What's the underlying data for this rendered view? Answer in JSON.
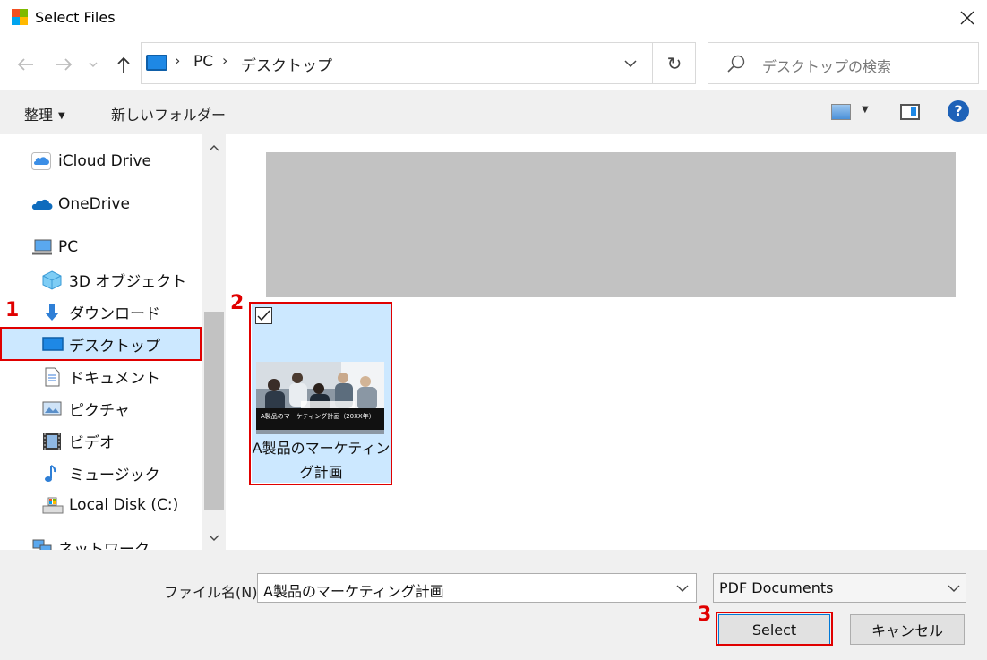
{
  "window": {
    "title": "Select Files",
    "close_icon": "close-icon"
  },
  "nav": {
    "back_icon": "arrow-left-icon",
    "forward_icon": "arrow-right-icon",
    "recent_icon": "chevron-down-icon",
    "up_icon": "arrow-up-icon"
  },
  "address": {
    "crumbs": [
      "PC",
      "デスクトップ"
    ],
    "refresh_icon": "refresh-icon"
  },
  "search": {
    "placeholder": "デスクトップの検索"
  },
  "toolbar": {
    "organize_label": "整理",
    "new_folder_label": "新しいフォルダー",
    "help_label": "?"
  },
  "sidebar": {
    "items": [
      {
        "label": "iCloud Drive",
        "icon": "icloud-icon"
      },
      {
        "label": "OneDrive",
        "icon": "onedrive-icon"
      },
      {
        "label": "PC",
        "icon": "pc-icon"
      },
      {
        "label": "3D オブジェクト",
        "icon": "3d-objects-icon"
      },
      {
        "label": "ダウンロード",
        "icon": "download-icon"
      },
      {
        "label": "デスクトップ",
        "icon": "desktop-icon",
        "selected": true
      },
      {
        "label": "ドキュメント",
        "icon": "documents-icon"
      },
      {
        "label": "ピクチャ",
        "icon": "pictures-icon"
      },
      {
        "label": "ビデオ",
        "icon": "video-icon"
      },
      {
        "label": "ミュージック",
        "icon": "music-icon"
      },
      {
        "label": "Local Disk (C:)",
        "icon": "local-disk-icon"
      },
      {
        "label": "ネットワーク",
        "icon": "network-icon"
      }
    ]
  },
  "content": {
    "file": {
      "name": "A製品のマーケティング計画",
      "thumbnail_text": "A製品のマーケティング計画（20XX年）",
      "checked": true
    }
  },
  "footer": {
    "filename_label": "ファイル名(N):",
    "filename_value": "A製品のマーケティング計画",
    "filetype_value": "PDF Documents",
    "select_label": "Select",
    "cancel_label": "キャンセル"
  },
  "annotations": {
    "step1": "1",
    "step2": "2",
    "step3": "3",
    "color": "#e00000"
  }
}
